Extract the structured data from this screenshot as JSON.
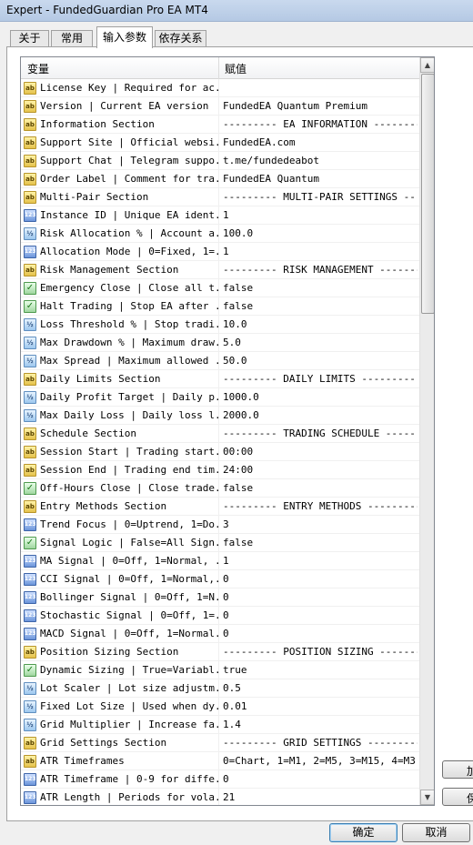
{
  "window": {
    "title": "Expert - FundedGuardian Pro EA MT4"
  },
  "tabs": [
    {
      "label": "关于",
      "active": false
    },
    {
      "label": "常用",
      "active": false
    },
    {
      "label": "输入参数",
      "active": true
    },
    {
      "label": "依存关系",
      "active": false
    }
  ],
  "grid": {
    "col_variable": "变量",
    "col_value": "赋值",
    "rows": [
      {
        "icon": "ab",
        "variable": "License Key | Required for ac...",
        "value": ""
      },
      {
        "icon": "ab",
        "variable": "Version | Current EA version",
        "value": "FundedEA Quantum Premium"
      },
      {
        "icon": "ab",
        "variable": "Information Section",
        "value": "--------- EA INFORMATION ---------"
      },
      {
        "icon": "ab",
        "variable": "Support Site | Official websi...",
        "value": "FundedEA.com"
      },
      {
        "icon": "ab",
        "variable": "Support Chat | Telegram suppo...",
        "value": "t.me/fundedeabot"
      },
      {
        "icon": "ab",
        "variable": "Order Label | Comment for tra...",
        "value": "FundedEA Quantum"
      },
      {
        "icon": "ab",
        "variable": "Multi-Pair Section",
        "value": "--------- MULTI-PAIR SETTINGS --..."
      },
      {
        "icon": "123",
        "variable": "Instance ID | Unique EA ident...",
        "value": "1"
      },
      {
        "icon": "v2",
        "variable": "Risk Allocation % | Account a...",
        "value": "100.0"
      },
      {
        "icon": "123",
        "variable": "Allocation Mode | 0=Fixed, 1=...",
        "value": "1"
      },
      {
        "icon": "ab",
        "variable": "Risk Management Section",
        "value": "--------- RISK MANAGEMENT ---------"
      },
      {
        "icon": "chk",
        "variable": "Emergency Close | Close all t...",
        "value": "false"
      },
      {
        "icon": "chk",
        "variable": "Halt Trading | Stop EA after ...",
        "value": "false"
      },
      {
        "icon": "v2",
        "variable": "Loss Threshold % | Stop tradi...",
        "value": "10.0"
      },
      {
        "icon": "v2",
        "variable": "Max Drawdown % | Maximum draw...",
        "value": "5.0"
      },
      {
        "icon": "v2",
        "variable": "Max Spread | Maximum allowed ...",
        "value": "50.0"
      },
      {
        "icon": "ab",
        "variable": "Daily Limits Section",
        "value": "--------- DAILY LIMITS ---------"
      },
      {
        "icon": "v2",
        "variable": "Daily Profit Target | Daily p...",
        "value": "1000.0"
      },
      {
        "icon": "v2",
        "variable": "Max Daily Loss | Daily loss l...",
        "value": "2000.0"
      },
      {
        "icon": "ab",
        "variable": "Schedule Section",
        "value": "--------- TRADING SCHEDULE -----..."
      },
      {
        "icon": "ab",
        "variable": "Session Start | Trading start...",
        "value": "00:00"
      },
      {
        "icon": "ab",
        "variable": "Session End | Trading end tim...",
        "value": "24:00"
      },
      {
        "icon": "chk",
        "variable": "Off-Hours Close | Close trade...",
        "value": "false"
      },
      {
        "icon": "ab",
        "variable": "Entry Methods Section",
        "value": "--------- ENTRY METHODS ---------"
      },
      {
        "icon": "123",
        "variable": "Trend Focus | 0=Uptrend, 1=Do...",
        "value": "3"
      },
      {
        "icon": "chk",
        "variable": "Signal Logic | False=All Sign...",
        "value": "false"
      },
      {
        "icon": "123",
        "variable": "MA Signal | 0=Off, 1=Normal, ...",
        "value": "1"
      },
      {
        "icon": "123",
        "variable": "CCI Signal | 0=Off, 1=Normal,...",
        "value": "0"
      },
      {
        "icon": "123",
        "variable": "Bollinger Signal | 0=Off, 1=N...",
        "value": "0"
      },
      {
        "icon": "123",
        "variable": "Stochastic Signal | 0=Off, 1=...",
        "value": "0"
      },
      {
        "icon": "123",
        "variable": "MACD Signal | 0=Off, 1=Normal...",
        "value": "0"
      },
      {
        "icon": "ab",
        "variable": "Position Sizing Section",
        "value": "--------- POSITION SIZING ---------"
      },
      {
        "icon": "chk",
        "variable": "Dynamic Sizing | True=Variabl...",
        "value": "true"
      },
      {
        "icon": "v2",
        "variable": "Lot Scaler | Lot size adjustm...",
        "value": "0.5"
      },
      {
        "icon": "v2",
        "variable": "Fixed Lot Size | Used when dy...",
        "value": "0.01"
      },
      {
        "icon": "v2",
        "variable": "Grid Multiplier | Increase fa...",
        "value": "1.4"
      },
      {
        "icon": "ab",
        "variable": "Grid Settings Section",
        "value": "--------- GRID SETTINGS ---------"
      },
      {
        "icon": "ab",
        "variable": "ATR Timeframes",
        "value": "0=Chart, 1=M1, 2=M5, 3=M15, 4=M3..."
      },
      {
        "icon": "123",
        "variable": "ATR Timeframe | 0-9 for diffe...",
        "value": "0"
      },
      {
        "icon": "123",
        "variable": "ATR Length | Periods for vola...",
        "value": "21"
      }
    ]
  },
  "side_buttons": [
    {
      "label": "加"
    },
    {
      "label": "保"
    }
  ],
  "buttons": {
    "ok": "确定",
    "cancel": "取消"
  }
}
